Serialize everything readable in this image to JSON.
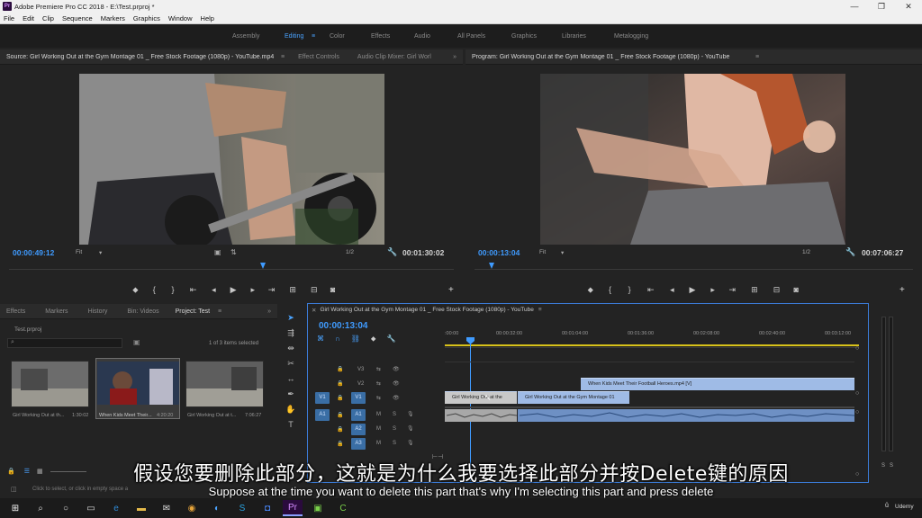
{
  "window": {
    "title": "Adobe Premiere Pro CC 2018 - E:\\Test.prproj *",
    "app_badge": "Pr",
    "minimize": "—",
    "maximize": "❐",
    "close": "✕"
  },
  "menu": [
    "File",
    "Edit",
    "Clip",
    "Sequence",
    "Markers",
    "Graphics",
    "Window",
    "Help"
  ],
  "workspaces": [
    {
      "label": "Assembly",
      "active": false
    },
    {
      "label": "Editing",
      "active": true
    },
    {
      "label": "Color",
      "active": false
    },
    {
      "label": "Effects",
      "active": false
    },
    {
      "label": "Audio",
      "active": false
    },
    {
      "label": "All Panels",
      "active": false
    },
    {
      "label": "Graphics",
      "active": false
    },
    {
      "label": "Libraries",
      "active": false
    },
    {
      "label": "Metalogging",
      "active": false
    }
  ],
  "source_panel": {
    "tabs": [
      "Source: Girl Working Out at the Gym Montage 01 _ Free Stock Footage (1080p) - YouTube.mp4",
      "Effect Controls",
      "Audio Clip Mixer: Girl Worl"
    ],
    "timecode_in": "00:00:49:12",
    "timecode_out": "00:01:30:02",
    "zoom": "Fit",
    "resolution": "1/2",
    "playhead_fraction": 0.57
  },
  "program_panel": {
    "tab": "Program: Girl Working Out at the Gym Montage 01 _ Free Stock Footage (1080p) - YouTube",
    "timecode_in": "00:00:13:04",
    "timecode_out": "00:07:06:27",
    "zoom": "Fit",
    "resolution": "1/2",
    "playhead_fraction": 0.04
  },
  "project_panel": {
    "tabs": [
      "Effects",
      "Markers",
      "History",
      "Bin: Videos",
      "Project: Test"
    ],
    "project_file": "Test.prproj",
    "selection_info": "1 of 3 items selected",
    "items": [
      {
        "label": "Girl Working Out at th...",
        "duration": "1:30:02"
      },
      {
        "label": "When Kids Meet Their...",
        "duration": "4:20:20"
      },
      {
        "label": "Girl Working Out at t...",
        "duration": "7:06:27"
      }
    ]
  },
  "timeline": {
    "sequence_tab": "Girl Working Out at the Gym Montage 01 _ Free Stock Footage (1080p) - YouTube",
    "timecode": "00:00:13:04",
    "ruler": [
      ":00:00",
      "00:00:32:00",
      "00:01:04:00",
      "00:01:36:00",
      "00:02:08:00",
      "00:02:40:00",
      "00:03:12:00"
    ],
    "video_tracks": [
      "V3",
      "V2",
      "V1"
    ],
    "audio_tracks": [
      "A1",
      "A2",
      "A3"
    ],
    "source_targets": {
      "video": "V1",
      "audio": "A1"
    },
    "clips": {
      "v2": "When Kids Meet Their Football Heroes.mp4 [V]",
      "v1_a": "Girl Working Out at the",
      "v1_b": "Girl Working Out at the Gym Montage 01"
    },
    "track_letters": {
      "mute": "M",
      "solo": "S"
    }
  },
  "status_bar": "Click to select, or click in empty space a",
  "subtitles": {
    "chinese": "假设您要删除此部分，这就是为什么我要选择此部分并按Delete键的原因",
    "english": "Suppose at the time you want to delete this part that's why I'm selecting this part and press delete"
  },
  "watermark": "Udemy",
  "meter_labels": [
    "S",
    "S"
  ]
}
